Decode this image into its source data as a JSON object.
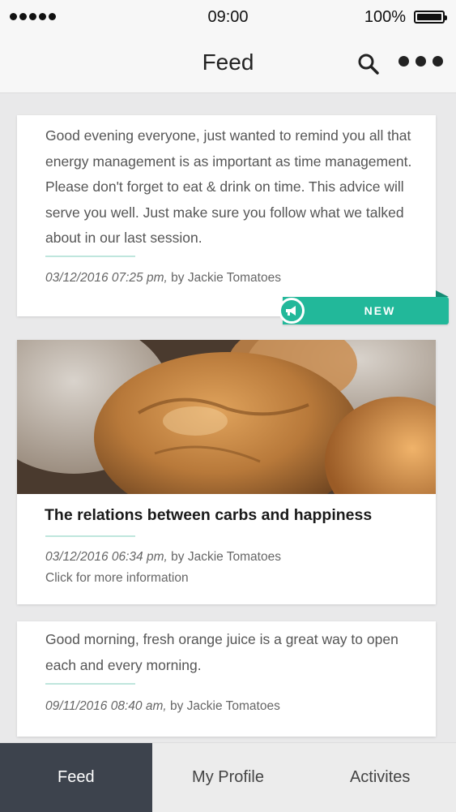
{
  "status_bar": {
    "time": "09:00",
    "battery": "100%"
  },
  "nav": {
    "title": "Feed",
    "icons": [
      "search-icon",
      "more-icon"
    ]
  },
  "feed": {
    "posts": [
      {
        "text": "Good evening everyone, just wanted to remind you all that energy management is as important as time management. Please don't forget to eat & drink on time. This advice will serve you well. Just make sure you follow what we talked about in our last session.",
        "date": "03/12/2016 07:25 pm,",
        "author": "by Jackie Tomatoes",
        "badge": "NEW"
      },
      {
        "image": "bread-photo",
        "title": "The relations between carbs and happiness",
        "date": "03/12/2016 06:34 pm,",
        "author": "by Jackie Tomatoes",
        "more": "Click for more information"
      },
      {
        "text": "Good morning, fresh orange juice is a great way to open each and every morning.",
        "date": "09/11/2016 08:40 am,",
        "author": "by Jackie Tomatoes"
      }
    ]
  },
  "tabs": [
    {
      "label": "Feed",
      "active": true
    },
    {
      "label": "My Profile",
      "active": false
    },
    {
      "label": "Activites",
      "active": false
    }
  ],
  "colors": {
    "accent": "#22b89a",
    "divider": "#bfe6dd",
    "tab_active_bg": "#3d434d"
  }
}
